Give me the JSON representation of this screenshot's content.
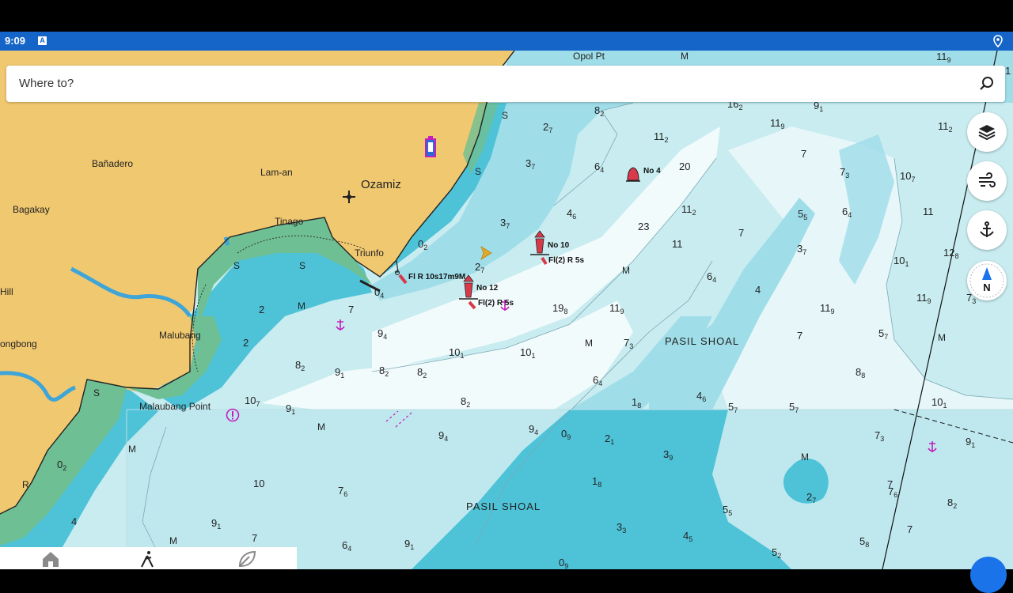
{
  "status_bar": {
    "time": "9:09",
    "notification_glyph": "A",
    "location_icon": "location-pin-icon"
  },
  "search": {
    "placeholder": "Where to?",
    "icon": "search-icon"
  },
  "map_controls": [
    {
      "name": "layers-button",
      "icon": "layers-icon"
    },
    {
      "name": "wind-button",
      "icon": "wind-icon"
    },
    {
      "name": "anchor-button",
      "icon": "anchor-icon"
    },
    {
      "name": "compass-button",
      "icon": "compass-icon",
      "label": "N"
    }
  ],
  "bottom_nav": [
    {
      "name": "home-tab",
      "icon": "home-icon"
    },
    {
      "name": "navigate-tab",
      "icon": "walk-icon"
    },
    {
      "name": "explore-tab",
      "icon": "leaf-icon"
    }
  ],
  "map_labels": {
    "places": [
      "Opol Pt",
      "Bañadero",
      "Lam-an",
      "Ozamiz",
      "Bagakay",
      "Tinago",
      "Triunfo",
      "Hill",
      "Malubang",
      "ongbong",
      "Malaubang Point"
    ],
    "shoals": [
      "PASIL SHOAL",
      "PASIL SHOAL"
    ],
    "buoys": [
      "No 4",
      "No 10",
      "Fl(2) R 5s",
      "No 12",
      "Fl(2) R 5s",
      "Fl R 10s17m9M"
    ],
    "seabed": [
      "S",
      "S",
      "S",
      "S",
      "S",
      "M",
      "M",
      "M",
      "M",
      "M",
      "M",
      "M",
      "M",
      "M",
      "R"
    ]
  },
  "soundings": [
    [
      "11",
      "9"
    ],
    [
      "1",
      ""
    ],
    [
      "16",
      "2"
    ],
    [
      "9",
      "1"
    ],
    [
      "11",
      "9"
    ],
    [
      "11",
      "2"
    ],
    [
      "8",
      "2"
    ],
    [
      "2",
      "7"
    ],
    [
      "3",
      "7"
    ],
    [
      "6",
      "4"
    ],
    [
      "11",
      "2"
    ],
    [
      "20",
      ""
    ],
    [
      "7",
      ""
    ],
    [
      "7",
      "3"
    ],
    [
      "10",
      "7"
    ],
    [
      "11",
      ""
    ],
    [
      "4",
      "6"
    ],
    [
      "3",
      "7"
    ],
    [
      "11",
      "2"
    ],
    [
      "5",
      "5"
    ],
    [
      "6",
      "4"
    ],
    [
      "23",
      ""
    ],
    [
      "0",
      "2"
    ],
    [
      "11",
      ""
    ],
    [
      "7",
      ""
    ],
    [
      "12",
      "8"
    ],
    [
      "10",
      "1"
    ],
    [
      "3",
      "7"
    ],
    [
      "2",
      "7"
    ],
    [
      "6",
      "4"
    ],
    [
      "4",
      ""
    ],
    [
      "11",
      "9"
    ],
    [
      "11",
      "9"
    ],
    [
      "7",
      "3"
    ],
    [
      "19",
      "8"
    ],
    [
      "11",
      "9"
    ],
    [
      "0",
      "4"
    ],
    [
      "2",
      ""
    ],
    [
      "7",
      ""
    ],
    [
      "9",
      "4"
    ],
    [
      "2",
      ""
    ],
    [
      "7",
      "3"
    ],
    [
      "7",
      ""
    ],
    [
      "5",
      "7"
    ],
    [
      "10",
      "1"
    ],
    [
      "10",
      "1"
    ],
    [
      "8",
      "2"
    ],
    [
      "9",
      "1"
    ],
    [
      "8",
      "2"
    ],
    [
      "8",
      "2"
    ],
    [
      "8",
      "8"
    ],
    [
      "6",
      "4"
    ],
    [
      "4",
      "6"
    ],
    [
      "10",
      "7"
    ],
    [
      "9",
      "1"
    ],
    [
      "1",
      "8"
    ],
    [
      "5",
      "7"
    ],
    [
      "5",
      "7"
    ],
    [
      "10",
      "1"
    ],
    [
      "8",
      "2"
    ],
    [
      "9",
      "4"
    ],
    [
      "9",
      "4"
    ],
    [
      "0",
      "9"
    ],
    [
      "2",
      "1"
    ],
    [
      "7",
      "3"
    ],
    [
      "9",
      "1"
    ],
    [
      "3",
      "9"
    ],
    [
      "0",
      "2"
    ],
    [
      "7",
      ""
    ],
    [
      "10",
      ""
    ],
    [
      "7",
      "6"
    ],
    [
      "1",
      "8"
    ],
    [
      "2",
      "7"
    ],
    [
      "7",
      "6"
    ],
    [
      "8",
      "2"
    ],
    [
      "4",
      ""
    ],
    [
      "5",
      "5"
    ],
    [
      "9",
      "1"
    ],
    [
      "7",
      ""
    ],
    [
      "3",
      "3"
    ],
    [
      "4",
      "5"
    ],
    [
      "7",
      ""
    ],
    [
      "6",
      "4"
    ],
    [
      "9",
      "1"
    ],
    [
      "5",
      "8"
    ],
    [
      "5",
      "2"
    ],
    [
      "0",
      "9"
    ]
  ],
  "colors": {
    "land": "#f0c870",
    "intertidal": "#6fbf94",
    "shallow": "#4ec3d8",
    "medium": "#9fdde8",
    "deep": "#c8ecf0",
    "deepest": "#f2fbfc",
    "status_bar": "#1565c8",
    "buoy_red": "#d93a4a",
    "anchorage": "#c21fbf"
  }
}
